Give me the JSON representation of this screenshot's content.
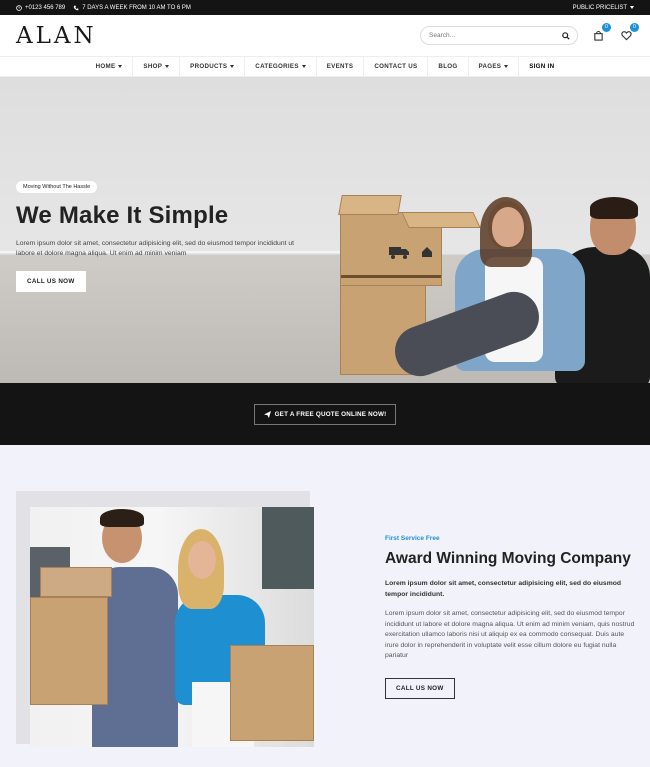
{
  "topbar": {
    "phone": "+0123 456 789",
    "hours": "7 DAYS A WEEK FROM 10 AM TO 6 PM",
    "pricelist": "PUBLIC PRICELIST"
  },
  "header": {
    "logo": "ALAN",
    "search_placeholder": "Search...",
    "cart_count": "0",
    "wishlist_count": "0"
  },
  "nav": {
    "items": [
      "HOME",
      "SHOP",
      "PRODUCTS",
      "CATEGORIES",
      "EVENTS",
      "CONTACT US",
      "BLOG",
      "PAGES",
      "SIGN IN"
    ]
  },
  "hero": {
    "pill": "Moving Without The Hassle",
    "title": "We Make It Simple",
    "text": "Lorem ipsum dolor sit amet, consectetur adipisicing elit, sed do eiusmod tempor incididunt ut labore et dolore magna aliqua. Ut enim ad minim veniam",
    "button": "CALL US NOW"
  },
  "cta": {
    "button": "GET A FREE QUOTE ONLINE NOW!"
  },
  "about": {
    "eyebrow": "First Service Free",
    "title": "Award Winning Moving Company",
    "lead": "Lorem ipsum dolor sit amet, consectetur adipisicing elit, sed do eiusmod tempor incididunt.",
    "body": "Lorem ipsum dolor sit amet, consectetur adipisicing elit, sed do eiusmod tempor incididunt ut labore et dolore magna aliqua. Ut enim ad minim veniam, quis nostrud exercitation ullamco laboris nisi ut aliquip ex ea commodo consequat. Duis aute irure dolor in reprehenderit in voluptate velit esse cillum dolore eu fugiat nulla pariatur",
    "button": "CALL US NOW"
  },
  "colors": {
    "accent": "#1e90d6",
    "dark": "#141414",
    "section_bg": "#f2f3fa"
  }
}
